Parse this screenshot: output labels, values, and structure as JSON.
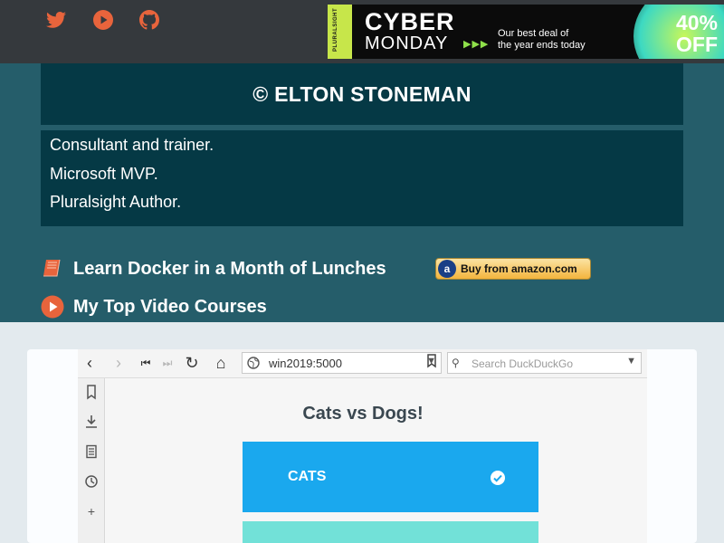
{
  "topbar": {
    "social": [
      {
        "icon": "twitter-icon"
      },
      {
        "icon": "youtube-icon"
      },
      {
        "icon": "github-icon"
      }
    ],
    "ad": {
      "brand_strip": "PLURALSIGHT",
      "headline1": "CYBER",
      "headline2": "MONDAY",
      "arrows": "▶▶▶",
      "tagline1": "Our best deal of",
      "tagline2": "the year ends today",
      "discount1": "40%",
      "discount2": "OFF"
    }
  },
  "profile": {
    "title": "© ELTON STONEMAN",
    "bio": [
      "Consultant and trainer.",
      "Microsoft MVP.",
      "Pluralsight Author."
    ],
    "book_link": "Learn Docker in a Month of Lunches",
    "amazon_button": "Buy from amazon.com",
    "courses_link": "My Top Video Courses"
  },
  "screenshot": {
    "url": "win2019:5000",
    "search_placeholder": "Search DuckDuckGo",
    "vote_title": "Cats vs Dogs!",
    "option_cats": "CATS"
  },
  "colors": {
    "accent": "#e8643c",
    "teal_bg": "#255d6a",
    "dark_box": "#053945",
    "cats": "#1aa8ee",
    "dogs": "#72e1d8"
  }
}
